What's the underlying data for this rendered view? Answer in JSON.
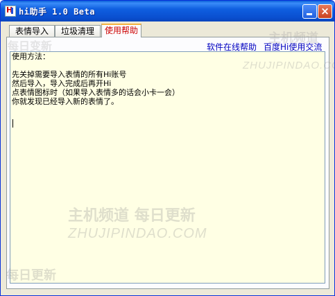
{
  "window": {
    "title": "hi助手 1.0 Beta"
  },
  "tabs": [
    {
      "label": "表情导入"
    },
    {
      "label": "垃圾清理"
    },
    {
      "label": "使用帮助",
      "active": true
    }
  ],
  "links": {
    "online_help": "软件在线帮助",
    "baidu_hi": "百度Hi使用交流"
  },
  "help": {
    "lines": [
      "使用方法：",
      "",
      "先关掉需要导入表情的所有Hi账号",
      "然后导入，导入完成后再开Hi",
      "点表情图标时（如果导入表情多的话会小卡一会）",
      "你就发现已经导入新的表情了。"
    ]
  },
  "watermarks": {
    "cn1": "主机频道",
    "cn1_sub": "每日更新",
    "en": "ZHUJIPINDAO.COM",
    "cn_small": "每日更新",
    "cn_top_left": "每日变新"
  },
  "colors": {
    "title_bar": "#0a5fd8",
    "active_tab_text": "#cc0000",
    "text_area_bg": "#ffffe4",
    "link": "#0000c0"
  }
}
